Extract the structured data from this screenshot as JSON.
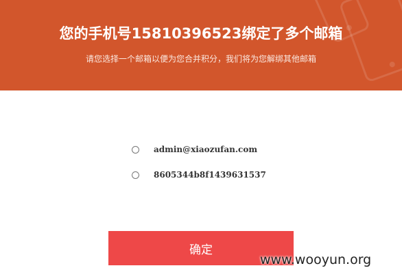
{
  "header": {
    "title": "您的手机号15810396523绑定了多个邮箱",
    "subtitle": "请您选择一个邮箱以便为您合并积分，我们将为您解绑其他邮箱"
  },
  "options": [
    {
      "label": "admin@xiaozufan.com"
    },
    {
      "label": "8605344b8f1439631537"
    }
  ],
  "confirm_label": "确定",
  "watermark": "www.wooyun.org",
  "colors": {
    "header_bg": "#d2562c",
    "button_bg": "#ee4848"
  },
  "icons": [
    "smartphone-icon",
    "tablet-icon"
  ]
}
